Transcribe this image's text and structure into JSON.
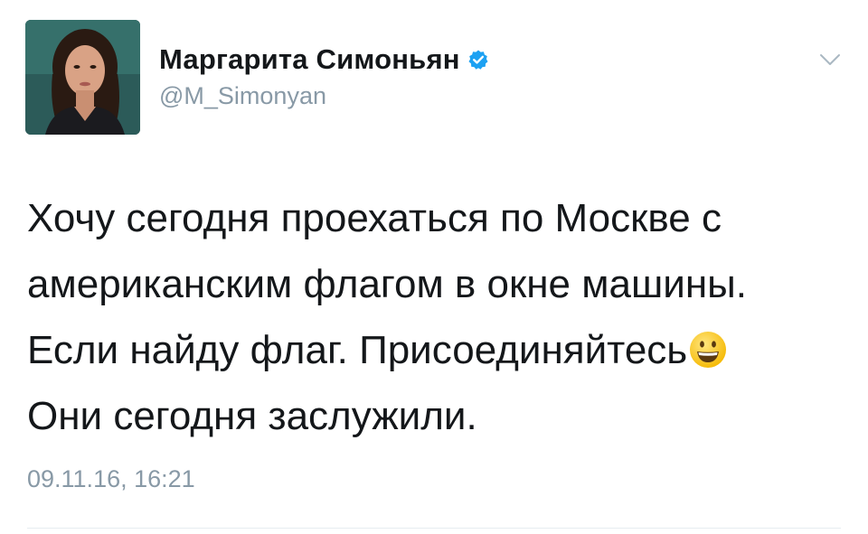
{
  "author": {
    "display_name": "Маргарита Симоньян",
    "handle": "@M_Simonyan",
    "verified": true
  },
  "tweet": {
    "lines": [
      "Хочу сегодня проехаться по Москве с",
      "американским флагом в окне машины.",
      "Если найду флаг. Присоединяйтесь",
      "Они сегодня заслужили."
    ],
    "emoji": "smiling-face-icon",
    "timestamp": "09.11.16, 16:21"
  },
  "colors": {
    "text": "#14171a",
    "secondary": "#8899a6",
    "verified_badge": "#1da1f2",
    "divider": "#e6ecf0"
  },
  "icons": {
    "verified": "verified-badge-icon",
    "menu": "chevron-down-icon"
  }
}
